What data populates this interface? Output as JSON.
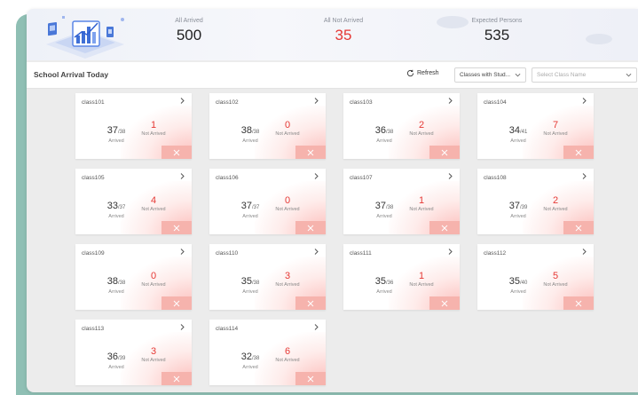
{
  "stats": [
    {
      "label": "All Arrived",
      "value": "500"
    },
    {
      "label": "All Not Arrived",
      "value": "35"
    },
    {
      "label": "Expected Persons",
      "value": "535"
    }
  ],
  "toolbar": {
    "title": "School Arrival Today",
    "refresh_label": "Refresh",
    "filter_value": "Classes with Stud...",
    "class_placeholder": "Select Class Name"
  },
  "labels": {
    "arrived": "Arrived",
    "not_arrived": "Not Arrived"
  },
  "colors": {
    "not_arrived_red": "#e53935",
    "card_accent": "#f6b3ad"
  },
  "classes": [
    {
      "name": "class101",
      "arrived": "37",
      "total": "/38",
      "not_arrived": "1"
    },
    {
      "name": "class102",
      "arrived": "38",
      "total": "/38",
      "not_arrived": "0"
    },
    {
      "name": "class103",
      "arrived": "36",
      "total": "/38",
      "not_arrived": "2"
    },
    {
      "name": "class104",
      "arrived": "34",
      "total": "/41",
      "not_arrived": "7"
    },
    {
      "name": "class105",
      "arrived": "33",
      "total": "/37",
      "not_arrived": "4"
    },
    {
      "name": "class106",
      "arrived": "37",
      "total": "/37",
      "not_arrived": "0"
    },
    {
      "name": "class107",
      "arrived": "37",
      "total": "/38",
      "not_arrived": "1"
    },
    {
      "name": "class108",
      "arrived": "37",
      "total": "/39",
      "not_arrived": "2"
    },
    {
      "name": "class109",
      "arrived": "38",
      "total": "/38",
      "not_arrived": "0"
    },
    {
      "name": "class110",
      "arrived": "35",
      "total": "/38",
      "not_arrived": "3"
    },
    {
      "name": "class111",
      "arrived": "35",
      "total": "/36",
      "not_arrived": "1"
    },
    {
      "name": "class112",
      "arrived": "35",
      "total": "/40",
      "not_arrived": "5"
    },
    {
      "name": "class113",
      "arrived": "36",
      "total": "/39",
      "not_arrived": "3"
    },
    {
      "name": "class114",
      "arrived": "32",
      "total": "/38",
      "not_arrived": "6"
    }
  ]
}
